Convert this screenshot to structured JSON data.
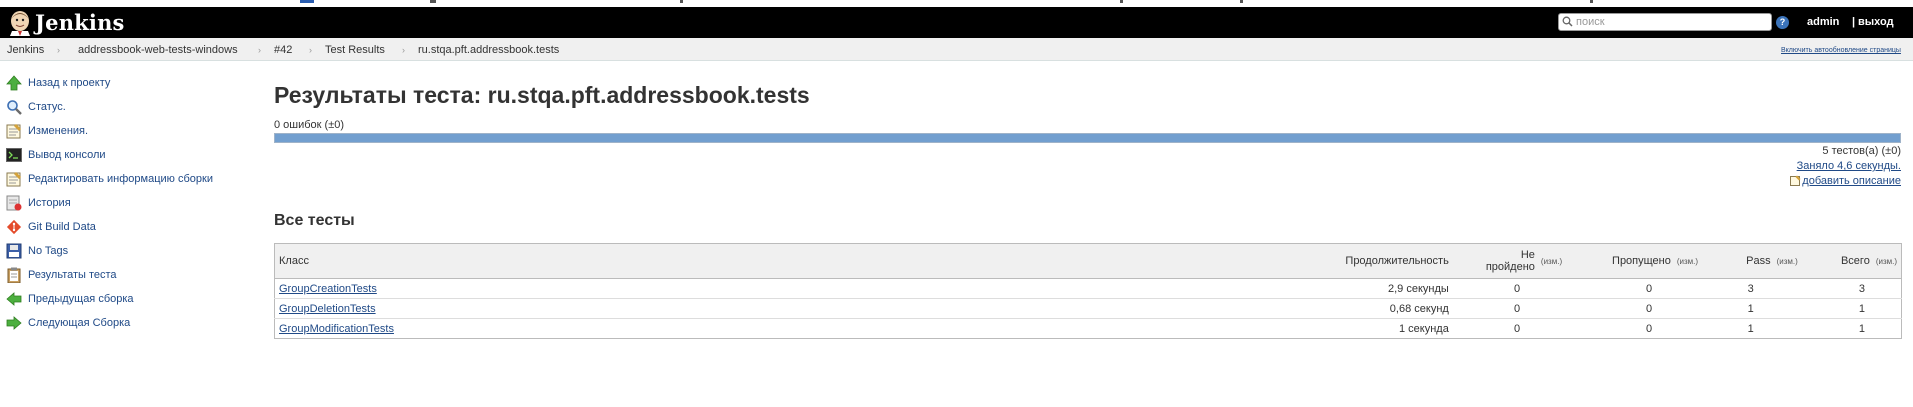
{
  "header": {
    "brand": "Jenkins",
    "search": {
      "placeholder": "поиск",
      "value": ""
    },
    "help_glyph": "?",
    "user": "admin",
    "separator": "|",
    "logout": "выход"
  },
  "breadcrumbs": {
    "items": [
      "Jenkins",
      "addressbook-web-tests-windows",
      "#42",
      "Test Results",
      "ru.stqa.pft.addressbook.tests"
    ],
    "separator_glyph": "›",
    "autorefresh": "Включить автообновление страницы"
  },
  "sidebar": {
    "items": [
      {
        "label": "Назад к проекту",
        "icon": "up-arrow-icon"
      },
      {
        "label": "Статус.",
        "icon": "search-icon"
      },
      {
        "label": "Изменения.",
        "icon": "notepad-icon"
      },
      {
        "label": "Вывод консоли",
        "icon": "terminal-icon"
      },
      {
        "label": "Редактировать информацию сборки",
        "icon": "notepad-icon"
      },
      {
        "label": "История",
        "icon": "history-icon"
      },
      {
        "label": "Git Build Data",
        "icon": "git-icon"
      },
      {
        "label": "No Tags",
        "icon": "save-icon"
      },
      {
        "label": "Результаты теста",
        "icon": "clipboard-icon"
      },
      {
        "label": "Предыдущая сборка",
        "icon": "previous-arrow-icon"
      },
      {
        "label": "Следующая Сборка",
        "icon": "next-arrow-icon"
      }
    ]
  },
  "main": {
    "title": "Результаты теста: ru.stqa.pft.addressbook.tests",
    "fail_summary": "0 ошибок (±0)",
    "pass_fraction": 1.0,
    "tests_count": "5 тестов(а) (±0)",
    "took": "Заняло 4,6 секунды.",
    "add_description": "добавить описание",
    "section_title": "Все тесты",
    "table": {
      "headers": {
        "class": "Класс",
        "duration": "Продолжительность",
        "failed_line1": "Не",
        "failed_line2": "пройдено",
        "skipped": "Пропущено",
        "pass": "Pass",
        "total": "Всего",
        "delta": "(изм.)"
      },
      "rows": [
        {
          "class": "GroupCreationTests",
          "duration": "2,9 секунды",
          "failed": "0",
          "skipped": "0",
          "pass": "3",
          "total": "3"
        },
        {
          "class": "GroupDeletionTests",
          "duration": "0,68 секунд",
          "failed": "0",
          "skipped": "0",
          "pass": "1",
          "total": "1"
        },
        {
          "class": "GroupModificationTests",
          "duration": "1 секунда",
          "failed": "0",
          "skipped": "0",
          "pass": "1",
          "total": "1"
        }
      ]
    }
  },
  "colors": {
    "header_bg": "#000000",
    "link": "#204a87",
    "pass_bar": "#729fcf",
    "breadcrumb_bg": "#f0f0f0",
    "table_header_bg": "#f0f0f0"
  }
}
